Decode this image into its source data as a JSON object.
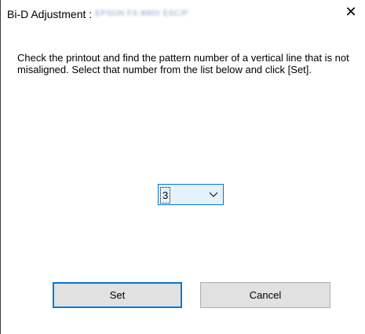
{
  "window": {
    "title_label": "Bi-D Adjustment :",
    "title_obscured": "EPSON FX-890II ESC/P",
    "close_glyph": "✕"
  },
  "instructions": "Check the printout and find the pattern number of a vertical line that is not misaligned. Select that number from the list below and click [Set].",
  "pattern_select": {
    "value": "3",
    "arrow_icon": "chevron-down-icon"
  },
  "buttons": {
    "set_label": "Set",
    "cancel_label": "Cancel"
  },
  "colors": {
    "focus_accent": "#0078d7",
    "button_face": "#e1e1e1",
    "select_highlight": "#e5f1fb"
  }
}
